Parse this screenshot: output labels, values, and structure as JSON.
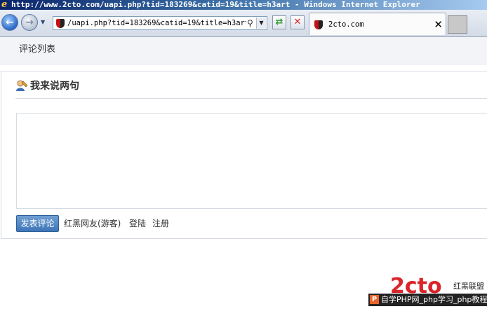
{
  "window": {
    "title": "http://www.2cto.com/uapi.php?tid=183269&catid=19&title=h3art - Windows Internet Explorer"
  },
  "toolbar": {
    "address_value": "/uapi.php?tid=183269&catid=19&title=h3art",
    "tab_title": "2cto.com"
  },
  "page": {
    "comment_list_label": "评论列表",
    "section_title": "我来说两句",
    "submit_label": "发表评论",
    "guest_label": "红黑网友(游客)",
    "login_label": "登陆",
    "register_label": "注册"
  },
  "watermark": {
    "logo_text": "2cto",
    "brand": "红黑联盟",
    "tagline": "自学PHP网_php学习_php教程"
  },
  "colors": {
    "accent": "#3f76b9",
    "logo_red": "#d9252a"
  }
}
